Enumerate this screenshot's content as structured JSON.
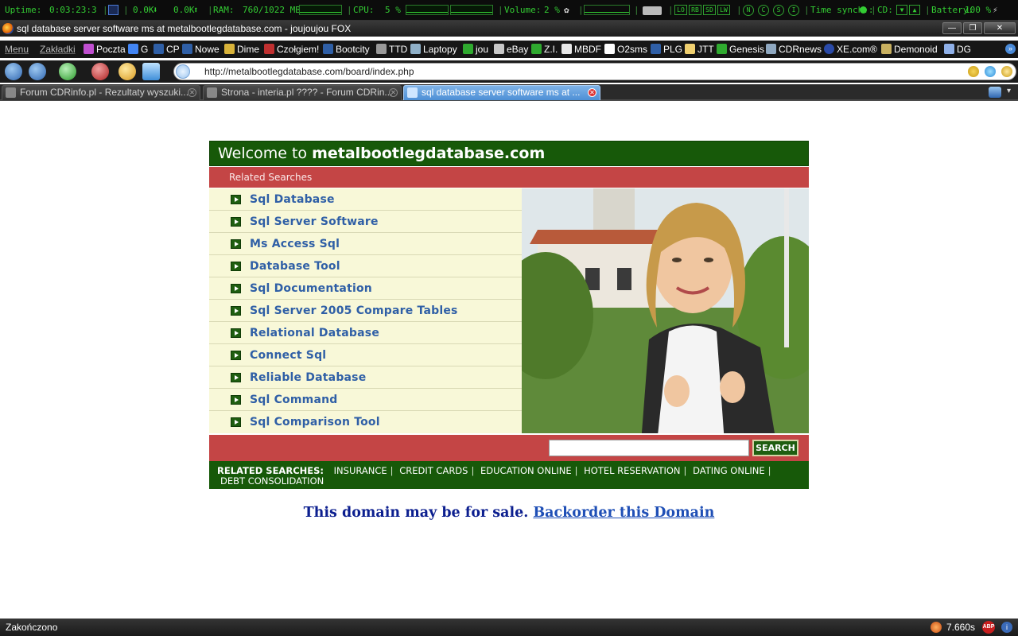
{
  "sysbar": {
    "uptime_label": "Uptime:",
    "uptime_value": "0:03:23:3",
    "net_down": "0.0K",
    "net_up": "0.0K",
    "ram_label": "RAM:",
    "ram_value": "760/1022 MB",
    "cpu_label": "CPU:",
    "cpu_value": "5 %",
    "volume_label": "Volume:",
    "volume_value": "2 %",
    "boxes": [
      "LO",
      "RB",
      "SD",
      "LW"
    ],
    "circles": [
      "N",
      "C",
      "S",
      "I"
    ],
    "time_sync_label": "Time synch.:",
    "cd_label": "CD:",
    "battery_label": "Battery:",
    "battery_value": "100 %"
  },
  "window": {
    "title": "sql database server software ms at metalbootlegdatabase.com - joujoujou FOX",
    "buttons": [
      "—",
      "❐",
      "✕"
    ]
  },
  "bookmarks": {
    "menu": "Menu",
    "zakladki": "Zakładki",
    "items": [
      {
        "label": "Poczta",
        "color": "#c04fd0"
      },
      {
        "label": "G",
        "color": "#4285f4"
      },
      {
        "label": "CP",
        "color": "#2f5fa6"
      },
      {
        "label": "Nowe",
        "color": "#2f5fa6"
      },
      {
        "label": "Dime",
        "color": "#d8b33a"
      },
      {
        "label": "Czołgiem!",
        "color": "#c03030"
      },
      {
        "label": "Bootcity",
        "color": "#2f5fa6"
      },
      {
        "label": "TTD",
        "color": "#9a9a9a"
      },
      {
        "label": "Laptopy",
        "color": "#8fb0c8"
      },
      {
        "label": "jou",
        "color": "#2faa2f"
      },
      {
        "label": "eBay",
        "color": "#c8c8c8"
      },
      {
        "label": "Z.I.",
        "color": "#2faa2f"
      },
      {
        "label": "MBDF",
        "color": "#e8e8e8"
      },
      {
        "label": "O2sms",
        "color": "#ffffff"
      },
      {
        "label": "PLG",
        "color": "#2f5fa6"
      },
      {
        "label": "JTT",
        "color": "#f0d070"
      },
      {
        "label": "Genesis",
        "color": "#2faa2f"
      },
      {
        "label": "CDRnews",
        "color": "#8fa8c0"
      },
      {
        "label": "XE.com®",
        "color": "#2a4aa8"
      },
      {
        "label": "Demonoid",
        "color": "#c8b060"
      },
      {
        "label": "DG",
        "color": "#8fb0e8"
      }
    ]
  },
  "navbar": {
    "url": "http://metalbootlegdatabase.com/board/index.php"
  },
  "tabs": [
    {
      "label": "Forum CDRinfo.pl - Rezultaty wyszuki...",
      "active": false
    },
    {
      "label": "Strona - interia.pl ???? - Forum CDRin...",
      "active": false
    },
    {
      "label": "sql database server software ms at ...",
      "active": true
    }
  ],
  "page": {
    "welcome_prefix": "Welcome to",
    "welcome_domain": "metalbootlegdatabase.com",
    "related_header": "Related Searches",
    "links": [
      "Sql Database",
      "Sql Server Software",
      "Ms Access Sql",
      "Database Tool",
      "Sql Documentation",
      "Sql Server 2005 Compare Tables",
      "Relational Database",
      "Connect Sql",
      "Reliable Database",
      "Sql Command",
      "Sql Comparison Tool"
    ],
    "search_button": "SEARCH",
    "search_value": "",
    "related_searches_label": "RELATED SEARCHES:",
    "related_searches": [
      "INSURANCE",
      "CREDIT CARDS",
      "EDUCATION ONLINE",
      "HOTEL RESERVATION",
      "DATING ONLINE",
      "DEBT CONSOLIDATION"
    ],
    "sale_text": "This domain may be for sale.",
    "sale_link": "Backorder this Domain"
  },
  "statusbar": {
    "text": "Zakończono",
    "timer": "7.660s"
  },
  "colors": {
    "green_dark": "#175909",
    "red_band": "#c44545",
    "cream": "#f8f8d8",
    "link_blue": "#2f5fa6"
  }
}
